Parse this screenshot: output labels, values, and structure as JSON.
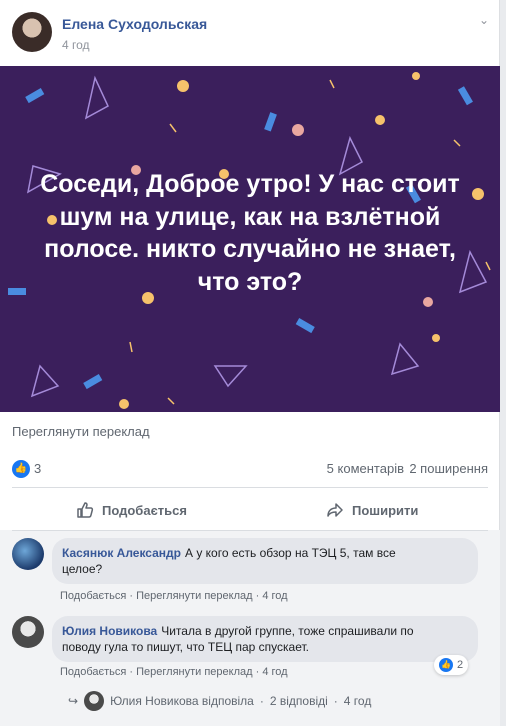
{
  "post": {
    "author": "Елена Суходольская",
    "time": "4 год",
    "banner_text": "Соседи, Доброе утро! У нас стоит шум на улице, как на взлётной полосе. никто случайно не знает, что это?",
    "translate_link": "Переглянути переклад",
    "background_color": "#3b1f5c"
  },
  "stats": {
    "likes": "3",
    "comments": "5 коментарів",
    "shares": "2 поширення"
  },
  "actions": {
    "like": "Подобається",
    "share": "Поширити"
  },
  "comments": [
    {
      "name": "Касянюк Александр",
      "text_line1": "А у кого есть обзор на ТЭЦ 5, там все",
      "text_line2": "целое?",
      "meta_like": "Подобається",
      "meta_translate": "Переглянути переклад",
      "meta_time": "4 год"
    },
    {
      "name": "Юлия Новикова",
      "text_line1": "Читала в другой группе, тоже спрашивали по",
      "text_line2": "поводу гула то пишут, что ТЕЦ пар спускает.",
      "meta_like": "Подобається",
      "meta_translate": "Переглянути переклад",
      "meta_time": "4 год",
      "reactions": "2"
    }
  ],
  "reply": {
    "text": "Юлия Новикова відповіла",
    "count": "2 відповіді",
    "time": "4 год"
  },
  "separator": "·",
  "icons": {
    "more": "chevron-down-icon",
    "like": "thumbs-up-icon",
    "share": "share-arrow-icon",
    "reply": "reply-arrow-icon"
  },
  "colors": {
    "link": "#385898",
    "like_blue": "#1877f2"
  }
}
